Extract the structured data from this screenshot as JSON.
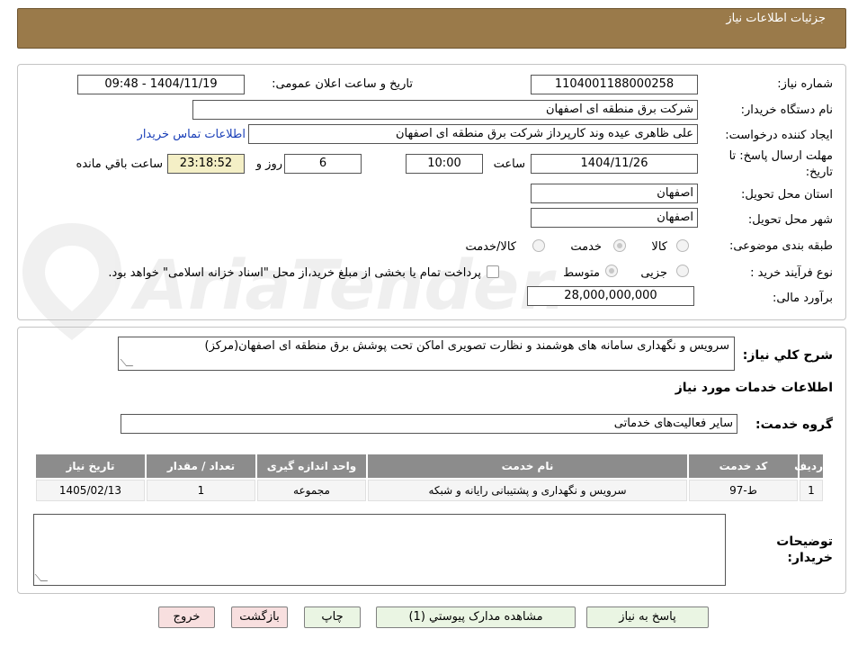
{
  "header": {
    "title": "جزئیات اطلاعات نیاز"
  },
  "form": {
    "need_number": {
      "label": "شماره نیاز:",
      "value": "1104001188000258"
    },
    "announce": {
      "label": "تاریخ و ساعت اعلان عمومی:",
      "value": "1404/11/19 - 09:48"
    },
    "buyer_org": {
      "label": "نام دستگاه خریدار:",
      "value": "شرکت برق منطقه ای اصفهان"
    },
    "creator": {
      "label": "ایجاد کننده درخواست:",
      "value": "علی ظاهری عیده وند کارپرداز شرکت برق منطقه ای اصفهان",
      "contact_link": "اطلاعات تماس خریدار"
    },
    "deadline": {
      "label_line1": "مهلت ارسال پاسخ: تا",
      "label_line2": "تاریخ:",
      "date": "1404/11/26",
      "time_label": "ساعت",
      "time": "10:00",
      "days": "6",
      "days_label": "روز و",
      "remaining": "23:18:52",
      "remaining_label": "ساعت باقي مانده"
    },
    "province": {
      "label": "استان محل تحویل:",
      "value": "اصفهان"
    },
    "city": {
      "label": "شهر محل تحویل:",
      "value": "اصفهان"
    },
    "category": {
      "label": "طبقه بندی موضوعی:",
      "options": [
        "کالا",
        "خدمت",
        "کالا/خدمت"
      ],
      "selected": "خدمت"
    },
    "process": {
      "label": "نوع فرآیند خرید :",
      "options": [
        "جزیی",
        "متوسط"
      ],
      "selected": "متوسط",
      "note": "پرداخت تمام یا بخشی از مبلغ خرید،از محل \"اسناد خزانه اسلامی\" خواهد بود."
    },
    "budget": {
      "label": "برآورد مالی:",
      "value": "28,000,000,000"
    }
  },
  "summary": {
    "label": "شرح کلي نياز:",
    "value": "سرویس و نگهداری سامانه های هوشمند و نظارت تصویری اماکن تحت پوشش برق منطقه ای اصفهان(مرکز)"
  },
  "services": {
    "heading": "اطلاعات خدمات مورد نياز",
    "group_label": "گروه خدمت:",
    "group_value": "سایر فعالیت‌های خدماتی",
    "table": {
      "headers": [
        "ردیف",
        "کد خدمت",
        "نام خدمت",
        "واحد اندازه گیری",
        "تعداد / مقدار",
        "تاریخ نیاز"
      ],
      "rows": [
        [
          "1",
          "ط-97",
          "سرویس و نگهداری و پشتیبانی رایانه و شبکه",
          "مجموعه",
          "1",
          "1405/02/13"
        ]
      ]
    }
  },
  "buyer_notes": {
    "label_line1": "توضیحات",
    "label_line2": "خریدار:",
    "value": ""
  },
  "buttons": {
    "reply": "پاسخ به نیاز",
    "attachments": "مشاهده مدارک پیوستي (1)",
    "print": "چاپ",
    "back": "بازگشت",
    "exit": "خروج"
  },
  "watermark": {
    "text": "AriaTender.neT"
  },
  "colors": {
    "header_bg": "#9a7a4a",
    "button_green": "#eaf5e3",
    "button_pink": "#f8dfdf",
    "table_header": "#8c8c8c",
    "highlight": "#f4efc6"
  }
}
